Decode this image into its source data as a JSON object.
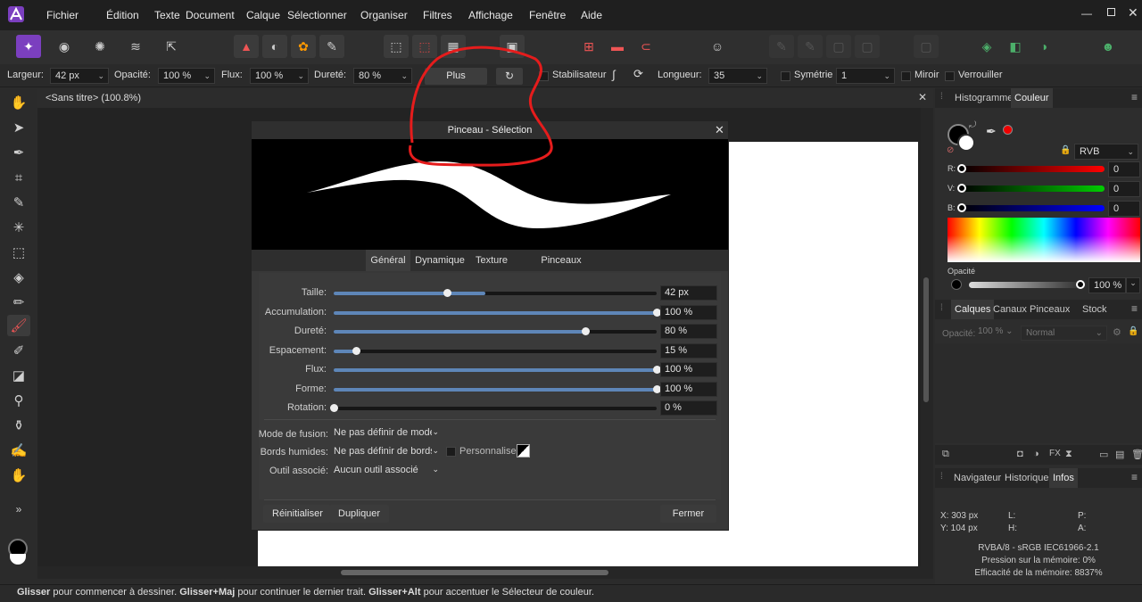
{
  "menu": [
    "Fichier",
    "Édition",
    "Texte",
    "Document",
    "Calque",
    "Sélectionner",
    "Organiser",
    "Filtres",
    "Affichage",
    "Fenêtre",
    "Aide"
  ],
  "context": {
    "largeur_label": "Largeur:",
    "largeur_value": "42 px",
    "opacite_label": "Opacité:",
    "opacite_value": "100 %",
    "flux_label": "Flux:",
    "flux_value": "100 %",
    "durete_label": "Dureté:",
    "durete_value": "80 %",
    "plus_label": "Plus",
    "stabilisateur_label": "Stabilisateur",
    "longueur_label": "Longueur:",
    "longueur_value": "35",
    "symetrie_label": "Symétrie",
    "symetrie_value": "1",
    "miroir_label": "Miroir",
    "verrouiller_label": "Verrouiller"
  },
  "document_tab": {
    "title": "<Sans titre> (100.8%)"
  },
  "dialog": {
    "title": "Pinceau - Sélection",
    "tabs": [
      "Général",
      "Dynamique",
      "Texture",
      "Pinceaux secondaires"
    ],
    "rows": [
      {
        "label": "Taille:",
        "value": "42 px",
        "pos": 0.35,
        "fill": 0.47
      },
      {
        "label": "Accumulation:",
        "value": "100 %",
        "pos": 1.0,
        "fill": 1.0
      },
      {
        "label": "Dureté:",
        "value": "80 %",
        "pos": 0.78,
        "fill": 0.78
      },
      {
        "label": "Espacement:",
        "value": "15 %",
        "pos": 0.07,
        "fill": 0.07
      },
      {
        "label": "Flux:",
        "value": "100 %",
        "pos": 1.0,
        "fill": 1.0
      },
      {
        "label": "Forme:",
        "value": "100 %",
        "pos": 1.0,
        "fill": 1.0
      },
      {
        "label": "Rotation:",
        "value": "0 %",
        "pos": 0.0,
        "fill": 0.0
      }
    ],
    "mode_fusion_label": "Mode de fusion:",
    "mode_fusion_value": "Ne pas définir de mode c",
    "bords_label": "Bords humides:",
    "bords_value": "Ne pas définir de bords h",
    "personnaliser_label": "Personnaliser",
    "outil_label": "Outil associé:",
    "outil_value": "Aucun outil associé",
    "reinit_label": "Réinitialiser",
    "dupliquer_label": "Dupliquer",
    "fermer_label": "Fermer"
  },
  "panels": {
    "color_tabs": [
      "Histogramme",
      "Couleur"
    ],
    "color_model": "RVB",
    "r_label": "R:",
    "r_value": "0",
    "v_label": "V:",
    "v_value": "0",
    "b_label": "B:",
    "b_value": "0",
    "opacite_label": "Opacité",
    "opacite_value": "100 %",
    "layer_tabs": [
      "Calques",
      "Canaux",
      "Pinceaux",
      "Stock"
    ],
    "layer_opacity_label": "Opacité:",
    "layer_opacity_value": "100 %",
    "blend_mode": "Normal",
    "nav_tabs": [
      "Navigateur",
      "Historique",
      "Infos"
    ],
    "x_coord": "X: 303 px",
    "y_coord": "Y: 104 px",
    "l_label": "L:",
    "h_label": "H:",
    "p_label": "P:",
    "a_label": "A:",
    "color_profile": "RVBA/8 - sRGB IEC61966-2.1",
    "memory_pressure": "Pression sur la mémoire: 0%",
    "memory_efficiency": "Efficacité de la mémoire: 8837%"
  },
  "status": {
    "k1": "Glisser",
    "t1": " pour commencer à dessiner. ",
    "k2": "Glisser",
    "k2b": "+Maj",
    "t2": " pour continuer le dernier trait. ",
    "k3": "Glisser",
    "k3b": "+Alt",
    "t3": " pour accentuer le Sélecteur de couleur."
  },
  "colors": {
    "annotation": "#e51c1c",
    "accent": "#5e86b8"
  }
}
